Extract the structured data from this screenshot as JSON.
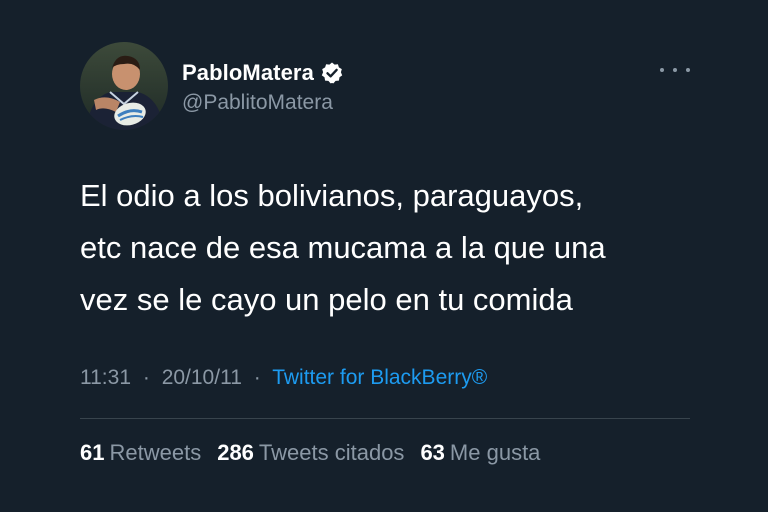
{
  "user": {
    "display_name": "PabloMatera",
    "handle": "@PablitoMatera",
    "verified": true,
    "avatar_icon": "profile-photo"
  },
  "tweet": {
    "lines": [
      "El odio a los bolivianos, paraguayos,",
      "etc nace de esa mucama a la que una",
      "vez se le cayo un pelo en tu comida"
    ],
    "time": "11:31",
    "date": "20/10/11",
    "separator": "·",
    "source": "Twitter for BlackBerry®"
  },
  "stats": {
    "retweets_count": "61",
    "retweets_label": "Retweets",
    "quotes_count": "286",
    "quotes_label": "Tweets citados",
    "likes_count": "63",
    "likes_label": "Me gusta"
  },
  "colors": {
    "background": "#15202b",
    "text": "#ffffff",
    "secondary": "#8b98a5",
    "link": "#1d9bf0",
    "divider": "#38444d"
  }
}
